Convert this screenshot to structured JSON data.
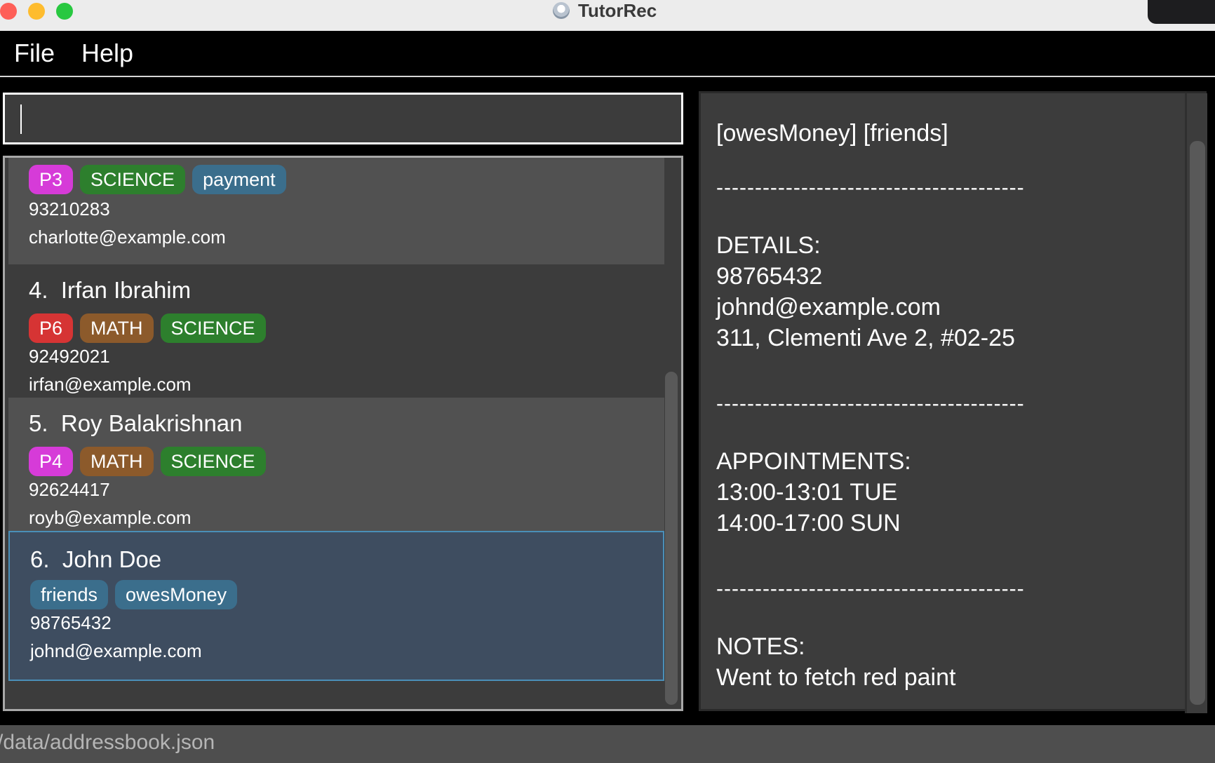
{
  "window": {
    "title": "TutorRec"
  },
  "menu": {
    "file": "File",
    "help": "Help"
  },
  "command": {
    "value": "",
    "placeholder": ""
  },
  "persons": [
    {
      "index": "",
      "name": "",
      "tags": [
        {
          "label": "P3",
          "color": "#d63bd8"
        },
        {
          "label": "SCIENCE",
          "color": "#2d7f2d"
        },
        {
          "label": "payment",
          "color": "#3b6e8c"
        }
      ],
      "phone": "93210283",
      "email": "charlotte@example.com"
    },
    {
      "index": "4.",
      "name": "Irfan Ibrahim",
      "tags": [
        {
          "label": "P6",
          "color": "#d63434"
        },
        {
          "label": "MATH",
          "color": "#8c5a2b"
        },
        {
          "label": "SCIENCE",
          "color": "#2d7f2d"
        }
      ],
      "phone": "92492021",
      "email": "irfan@example.com"
    },
    {
      "index": "5.",
      "name": "Roy Balakrishnan",
      "tags": [
        {
          "label": "P4",
          "color": "#d63bd8"
        },
        {
          "label": "MATH",
          "color": "#8c5a2b"
        },
        {
          "label": "SCIENCE",
          "color": "#2d7f2d"
        }
      ],
      "phone": "92624417",
      "email": "royb@example.com"
    },
    {
      "index": "6.",
      "name": "John Doe",
      "tags": [
        {
          "label": "friends",
          "color": "#3b6e8c"
        },
        {
          "label": "owesMoney",
          "color": "#3b6e8c"
        }
      ],
      "phone": "98765432",
      "email": "johnd@example.com"
    }
  ],
  "details": {
    "tags": "[owesMoney] [friends]",
    "divider": "----------------------------------------",
    "details_heading": "DETAILS:",
    "phone": "98765432",
    "email": "johnd@example.com",
    "address": "311, Clementi Ave 2, #02-25",
    "appointments_heading": "APPOINTMENTS:",
    "appointment_1": "13:00-13:01 TUE",
    "appointment_2": "14:00-17:00 SUN",
    "notes_heading": "NOTES:",
    "note": "Went to fetch red paint"
  },
  "status": {
    "path": "/data/addressbook.json"
  }
}
